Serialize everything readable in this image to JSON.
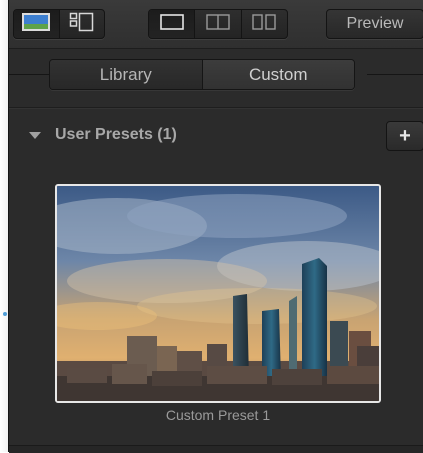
{
  "toolbar": {
    "view_buttons": [
      {
        "icon": "single-thumbnail-icon",
        "active": true
      },
      {
        "icon": "grid-list-icon",
        "active": false
      }
    ],
    "layout_buttons": [
      {
        "icon": "single-pane-icon",
        "active": true
      },
      {
        "icon": "split-vertical-icon",
        "active": false
      },
      {
        "icon": "side-by-side-icon",
        "active": false
      }
    ],
    "preview_label": "Preview"
  },
  "tabs": [
    {
      "label": "Library",
      "selected": false
    },
    {
      "label": "Custom",
      "selected": true
    }
  ],
  "section": {
    "title": "User Presets (1)",
    "add_label": "+"
  },
  "presets": [
    {
      "label": "Custom Preset 1"
    }
  ],
  "colors": {
    "panel_bg": "#2b2b2b",
    "text": "#b5b5b5",
    "accent_icon": "#3d7fd0"
  }
}
